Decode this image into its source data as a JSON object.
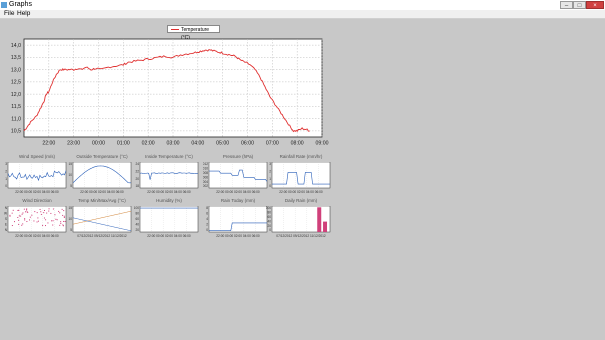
{
  "window": {
    "title": "Graphs",
    "buttons": {
      "minimize": "–",
      "maximize": "□",
      "close": "×"
    }
  },
  "menu": {
    "file": "File",
    "help": "Help"
  },
  "main_chart": {
    "legend": "Temperature (°C)",
    "color": "#e03030"
  },
  "chart_data": [
    {
      "type": "line",
      "title": "",
      "series": [
        {
          "name": "Temperature (°C)",
          "color": "#e03030",
          "points": [
            [
              21.0,
              10.5
            ],
            [
              21.15,
              10.7
            ],
            [
              21.3,
              10.9
            ],
            [
              21.5,
              11.1
            ],
            [
              21.65,
              11.4
            ],
            [
              21.8,
              11.7
            ],
            [
              21.9,
              12.0
            ],
            [
              22.0,
              12.1
            ],
            [
              22.15,
              12.5
            ],
            [
              22.3,
              12.8
            ],
            [
              22.45,
              13.0
            ],
            [
              22.6,
              13.0
            ],
            [
              22.8,
              13.0
            ],
            [
              23.0,
              13.0
            ],
            [
              23.15,
              13.05
            ],
            [
              23.3,
              13.0
            ],
            [
              23.5,
              13.1
            ],
            [
              23.7,
              13.0
            ],
            [
              23.9,
              13.05
            ],
            [
              24.1,
              13.0
            ],
            [
              24.4,
              13.1
            ],
            [
              24.7,
              13.15
            ],
            [
              25.0,
              13.2
            ],
            [
              25.2,
              13.3
            ],
            [
              25.5,
              13.35
            ],
            [
              25.8,
              13.4
            ],
            [
              26.1,
              13.45
            ],
            [
              26.4,
              13.5
            ],
            [
              26.7,
              13.55
            ],
            [
              27.0,
              13.5
            ],
            [
              27.3,
              13.6
            ],
            [
              27.6,
              13.65
            ],
            [
              27.9,
              13.7
            ],
            [
              28.1,
              13.75
            ],
            [
              28.3,
              13.8
            ],
            [
              28.5,
              13.8
            ],
            [
              28.7,
              13.75
            ],
            [
              28.9,
              13.7
            ],
            [
              29.1,
              13.65
            ],
            [
              29.3,
              13.6
            ],
            [
              29.5,
              13.55
            ],
            [
              29.7,
              13.4
            ],
            [
              29.9,
              13.3
            ],
            [
              30.1,
              13.2
            ],
            [
              30.3,
              13.0
            ],
            [
              30.5,
              12.7
            ],
            [
              30.7,
              12.3
            ],
            [
              30.9,
              11.9
            ],
            [
              31.1,
              11.6
            ],
            [
              31.3,
              11.3
            ],
            [
              31.5,
              11.0
            ],
            [
              31.7,
              10.7
            ],
            [
              31.85,
              10.5
            ],
            [
              32.0,
              10.5
            ],
            [
              32.2,
              10.6
            ],
            [
              32.4,
              10.55
            ],
            [
              32.5,
              10.5
            ]
          ]
        }
      ],
      "xlabel": "",
      "ylabel": "",
      "x_ticks": [
        "22:00",
        "23:00",
        "00:00",
        "01:00",
        "02:00",
        "03:00",
        "04:00",
        "05:00",
        "06:00",
        "07:00",
        "08:00",
        "09:00"
      ],
      "y_ticks": [
        "10,5",
        "11,0",
        "11,5",
        "12,0",
        "12,5",
        "13,0",
        "13,5",
        "14,0"
      ],
      "xlim": [
        21.0,
        33.0
      ],
      "ylim": [
        10.25,
        14.25
      ],
      "grid": true
    }
  ],
  "mini_charts": [
    {
      "title": "Wind Speed (m/s)",
      "color": "#2a5fb8",
      "yticks": [
        "3",
        "2",
        "1",
        "0"
      ],
      "xlabels": "22:00 00:00 02:00 04:00 06:00",
      "shape": "noisy-low"
    },
    {
      "title": "Outside Temperature (°C)",
      "color": "#2a5fb8",
      "yticks": [
        "15",
        "10",
        "5"
      ],
      "xlabels": "22:00 00:00 02:00 04:00 06:00",
      "shape": "hump"
    },
    {
      "title": "Inside Temperature (°C)",
      "color": "#2a5fb8",
      "yticks": [
        "24",
        "22",
        "20",
        "18"
      ],
      "xlabels": "22:00 00:00 02:00 04:00 06:00",
      "shape": "flat-dip"
    },
    {
      "title": "Pressure (hPa)",
      "color": "#2a5fb8",
      "yticks": [
        "1012",
        "1010",
        "1008",
        "1006",
        "1004",
        "1002"
      ],
      "xlabels": "22:00 00:00 02:00 04:00 06:00",
      "shape": "steps-down"
    },
    {
      "title": "Rainfall Rate (mm/hr)",
      "color": "#2a5fb8",
      "yticks": [
        "3",
        "2",
        "1",
        "0"
      ],
      "xlabels": "22:00 00:00 02:00 04:00 06:00",
      "shape": "pulses"
    },
    {
      "title": "Wind Direction",
      "color": "#d0407a",
      "yticks": [
        "N",
        "W",
        "S",
        "E",
        "N"
      ],
      "xlabels": "22:00 00:00 02:00 04:00 06:00",
      "shape": "scatter"
    },
    {
      "title": "Temp Min/Max/Avg (°C)",
      "color": "#2a5fb8",
      "yticks": [
        "15",
        "10",
        "5"
      ],
      "xlabels": "07/12/2012   09/12/2012   11/12/2012",
      "shape": "minmax"
    },
    {
      "title": "Humidity (%)",
      "color": "#2a5fb8",
      "yticks": [
        "100",
        "80",
        "60",
        "40",
        "20"
      ],
      "xlabels": "22:00 00:00 02:00 04:00 06:00",
      "shape": "top-flat"
    },
    {
      "title": "Rain Today (mm)",
      "color": "#2a5fb8",
      "yticks": [
        "8",
        "6",
        "4",
        "2",
        "0"
      ],
      "xlabels": "22:00 00:00 02:00 04:00 06:00",
      "shape": "step-up"
    },
    {
      "title": "Daily Rain (mm)",
      "color": "#d0407a",
      "yticks": [
        "100",
        "80",
        "60",
        "40",
        "20",
        "0"
      ],
      "xlabels": "07/12/2012   09/12/2012   11/12/2012",
      "shape": "bars"
    }
  ]
}
